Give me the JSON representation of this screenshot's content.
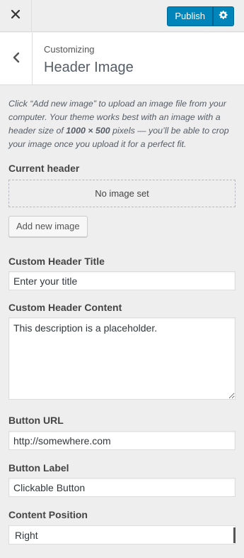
{
  "header": {
    "publish_label": "Publish"
  },
  "section": {
    "customizing_label": "Customizing",
    "title": "Header Image"
  },
  "description": {
    "part1": "Click “Add new image” to upload an image file from your computer. Your theme works best with an image with a header size of ",
    "size": "1000 × 500",
    "part2": " pixels — you’ll be able to crop your image once you upload it for a perfect fit."
  },
  "current_header": {
    "label": "Current header",
    "no_image": "No image set",
    "add_button": "Add new image"
  },
  "fields": {
    "title_label": "Custom Header Title",
    "title_value": "Enter your title",
    "content_label": "Custom Header Content",
    "content_value": "This description is a placeholder.",
    "url_label": "Button URL",
    "url_value": "http://somewhere.com",
    "button_label_label": "Button Label",
    "button_label_value": "Clickable Button",
    "position_label": "Content Position",
    "position_value": "Right"
  },
  "colors": {
    "primary": "#0085ba",
    "background": "#eeeeee"
  },
  "icons": {
    "close": "close-icon",
    "settings": "gear-icon",
    "back": "chevron-left-icon"
  }
}
